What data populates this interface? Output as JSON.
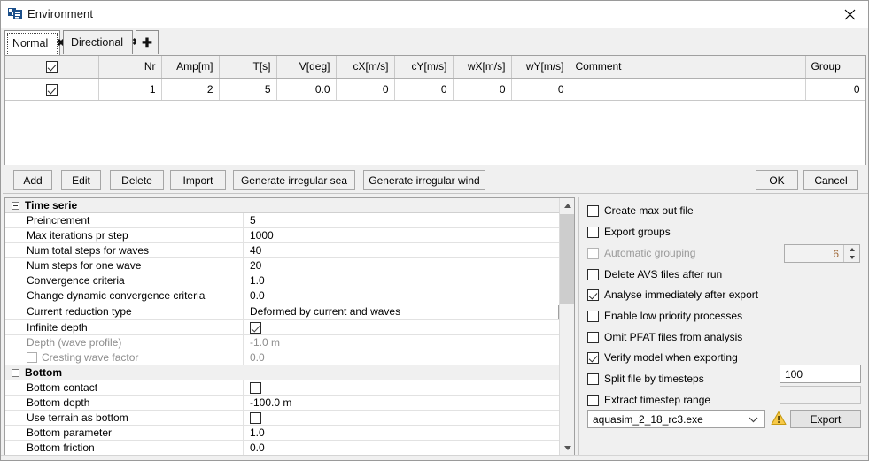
{
  "window": {
    "title": "Environment",
    "icon": "environment-app-icon",
    "close_label": "✕"
  },
  "tabs": {
    "items": [
      {
        "label": "Normal",
        "selected": true,
        "close": "✖"
      },
      {
        "label": "Directional",
        "selected": false,
        "close": "✖"
      }
    ],
    "add_label": "＋"
  },
  "grid": {
    "columns": [
      {
        "key": "enabled",
        "label": "",
        "type": "checkbox"
      },
      {
        "key": "nr",
        "label": "Nr",
        "align": "right"
      },
      {
        "key": "amp",
        "label": "Amp[m]",
        "align": "right"
      },
      {
        "key": "t",
        "label": "T[s]",
        "align": "right"
      },
      {
        "key": "v",
        "label": "V[deg]",
        "align": "right"
      },
      {
        "key": "cx",
        "label": "cX[m/s]",
        "align": "right"
      },
      {
        "key": "cy",
        "label": "cY[m/s]",
        "align": "right"
      },
      {
        "key": "wx",
        "label": "wX[m/s]",
        "align": "right"
      },
      {
        "key": "wy",
        "label": "wY[m/s]",
        "align": "right"
      },
      {
        "key": "comment",
        "label": "Comment",
        "align": "left"
      },
      {
        "key": "group",
        "label": "Group",
        "align": "right"
      }
    ],
    "header_checkbox": true,
    "rows": [
      {
        "enabled": true,
        "nr": "1",
        "amp": "2",
        "t": "5",
        "v": "0.0",
        "cx": "0",
        "cy": "0",
        "wx": "0",
        "wy": "0",
        "comment": "",
        "group": "0"
      }
    ]
  },
  "toolbar": {
    "add": "Add",
    "edit": "Edit",
    "delete": "Delete",
    "import": "Import",
    "gen_sea": "Generate irregular sea",
    "gen_wind": "Generate irregular wind",
    "ok": "OK",
    "cancel": "Cancel"
  },
  "properties": {
    "groups": [
      {
        "title": "Time serie",
        "rows": [
          {
            "name": "Preincrement",
            "value": "5",
            "type": "text"
          },
          {
            "name": "Max iterations pr step",
            "value": "1000",
            "type": "text"
          },
          {
            "name": "Num total steps for waves",
            "value": "40",
            "type": "text"
          },
          {
            "name": "Num steps for one wave",
            "value": "20",
            "type": "text"
          },
          {
            "name": "Convergence criteria",
            "value": "1.0",
            "type": "text"
          },
          {
            "name": "Change dynamic convergence criteria",
            "value": "0.0",
            "type": "text"
          },
          {
            "name": "Current reduction type",
            "value": "Deformed by current and waves",
            "type": "combo"
          },
          {
            "name": "Infinite depth",
            "value": "",
            "type": "checkbox",
            "checked": true
          },
          {
            "name": "Depth (wave profile)",
            "value": "-1.0 m",
            "type": "text",
            "disabled": true
          },
          {
            "name": "Cresting wave factor",
            "value": "0.0",
            "type": "text",
            "disabled": true,
            "name_checkbox": true
          }
        ]
      },
      {
        "title": "Bottom",
        "rows": [
          {
            "name": "Bottom contact",
            "value": "",
            "type": "checkbox",
            "checked": false
          },
          {
            "name": "Bottom depth",
            "value": "-100.0 m",
            "type": "text"
          },
          {
            "name": "Use terrain as bottom",
            "value": "",
            "type": "checkbox",
            "checked": false
          },
          {
            "name": "Bottom parameter",
            "value": "1.0",
            "type": "text"
          },
          {
            "name": "Bottom friction",
            "value": "0.0",
            "type": "text"
          }
        ]
      }
    ]
  },
  "options": {
    "checkboxes": [
      {
        "label": "Create max out file",
        "checked": false,
        "disabled": false
      },
      {
        "label": "Export groups",
        "checked": false,
        "disabled": false
      },
      {
        "label": "Automatic grouping",
        "checked": false,
        "disabled": true
      },
      {
        "label": "Delete AVS files after run",
        "checked": false,
        "disabled": false
      },
      {
        "label": "Analyse immediately after export",
        "checked": true,
        "disabled": false
      },
      {
        "label": "Enable low priority processes",
        "checked": false,
        "disabled": false
      },
      {
        "label": "Omit PFAT files from analysis",
        "checked": false,
        "disabled": false
      },
      {
        "label": "Verify model when exporting",
        "checked": true,
        "disabled": false
      },
      {
        "label": "Split file by timesteps",
        "checked": false,
        "disabled": false
      },
      {
        "label": "Extract timestep range",
        "checked": false,
        "disabled": false
      }
    ],
    "grouping_count": "6",
    "split_timesteps_value": "100",
    "extract_range_value": "",
    "executable": "aquasim_2_18_rc3.exe",
    "export_label": "Export",
    "warning_icon": "warning-triangle-icon"
  },
  "colors": {
    "accent": "#0e3e6e",
    "panel": "#f0f0f0",
    "field": "#ffffff",
    "border": "#a0a0a0",
    "scroll_thumb": "#cdcdcd",
    "warning": "#f5b82e",
    "disabled_text": "#8d8d8d",
    "spin_value": "#a06a3a"
  }
}
